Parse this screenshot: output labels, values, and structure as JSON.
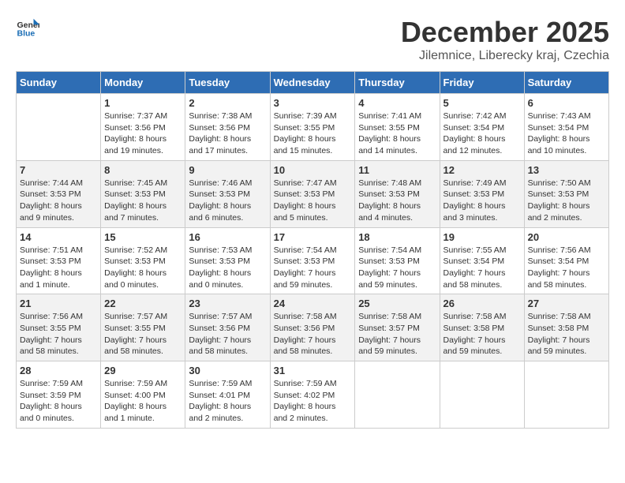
{
  "logo": {
    "general": "General",
    "blue": "Blue"
  },
  "title": "December 2025",
  "location": "Jilemnice, Liberecky kraj, Czechia",
  "days_of_week": [
    "Sunday",
    "Monday",
    "Tuesday",
    "Wednesday",
    "Thursday",
    "Friday",
    "Saturday"
  ],
  "weeks": [
    [
      {
        "day": "",
        "sunrise": "",
        "sunset": "",
        "daylight": ""
      },
      {
        "day": "1",
        "sunrise": "Sunrise: 7:37 AM",
        "sunset": "Sunset: 3:56 PM",
        "daylight": "Daylight: 8 hours and 19 minutes."
      },
      {
        "day": "2",
        "sunrise": "Sunrise: 7:38 AM",
        "sunset": "Sunset: 3:56 PM",
        "daylight": "Daylight: 8 hours and 17 minutes."
      },
      {
        "day": "3",
        "sunrise": "Sunrise: 7:39 AM",
        "sunset": "Sunset: 3:55 PM",
        "daylight": "Daylight: 8 hours and 15 minutes."
      },
      {
        "day": "4",
        "sunrise": "Sunrise: 7:41 AM",
        "sunset": "Sunset: 3:55 PM",
        "daylight": "Daylight: 8 hours and 14 minutes."
      },
      {
        "day": "5",
        "sunrise": "Sunrise: 7:42 AM",
        "sunset": "Sunset: 3:54 PM",
        "daylight": "Daylight: 8 hours and 12 minutes."
      },
      {
        "day": "6",
        "sunrise": "Sunrise: 7:43 AM",
        "sunset": "Sunset: 3:54 PM",
        "daylight": "Daylight: 8 hours and 10 minutes."
      }
    ],
    [
      {
        "day": "7",
        "sunrise": "Sunrise: 7:44 AM",
        "sunset": "Sunset: 3:53 PM",
        "daylight": "Daylight: 8 hours and 9 minutes."
      },
      {
        "day": "8",
        "sunrise": "Sunrise: 7:45 AM",
        "sunset": "Sunset: 3:53 PM",
        "daylight": "Daylight: 8 hours and 7 minutes."
      },
      {
        "day": "9",
        "sunrise": "Sunrise: 7:46 AM",
        "sunset": "Sunset: 3:53 PM",
        "daylight": "Daylight: 8 hours and 6 minutes."
      },
      {
        "day": "10",
        "sunrise": "Sunrise: 7:47 AM",
        "sunset": "Sunset: 3:53 PM",
        "daylight": "Daylight: 8 hours and 5 minutes."
      },
      {
        "day": "11",
        "sunrise": "Sunrise: 7:48 AM",
        "sunset": "Sunset: 3:53 PM",
        "daylight": "Daylight: 8 hours and 4 minutes."
      },
      {
        "day": "12",
        "sunrise": "Sunrise: 7:49 AM",
        "sunset": "Sunset: 3:53 PM",
        "daylight": "Daylight: 8 hours and 3 minutes."
      },
      {
        "day": "13",
        "sunrise": "Sunrise: 7:50 AM",
        "sunset": "Sunset: 3:53 PM",
        "daylight": "Daylight: 8 hours and 2 minutes."
      }
    ],
    [
      {
        "day": "14",
        "sunrise": "Sunrise: 7:51 AM",
        "sunset": "Sunset: 3:53 PM",
        "daylight": "Daylight: 8 hours and 1 minute."
      },
      {
        "day": "15",
        "sunrise": "Sunrise: 7:52 AM",
        "sunset": "Sunset: 3:53 PM",
        "daylight": "Daylight: 8 hours and 0 minutes."
      },
      {
        "day": "16",
        "sunrise": "Sunrise: 7:53 AM",
        "sunset": "Sunset: 3:53 PM",
        "daylight": "Daylight: 8 hours and 0 minutes."
      },
      {
        "day": "17",
        "sunrise": "Sunrise: 7:54 AM",
        "sunset": "Sunset: 3:53 PM",
        "daylight": "Daylight: 7 hours and 59 minutes."
      },
      {
        "day": "18",
        "sunrise": "Sunrise: 7:54 AM",
        "sunset": "Sunset: 3:53 PM",
        "daylight": "Daylight: 7 hours and 59 minutes."
      },
      {
        "day": "19",
        "sunrise": "Sunrise: 7:55 AM",
        "sunset": "Sunset: 3:54 PM",
        "daylight": "Daylight: 7 hours and 58 minutes."
      },
      {
        "day": "20",
        "sunrise": "Sunrise: 7:56 AM",
        "sunset": "Sunset: 3:54 PM",
        "daylight": "Daylight: 7 hours and 58 minutes."
      }
    ],
    [
      {
        "day": "21",
        "sunrise": "Sunrise: 7:56 AM",
        "sunset": "Sunset: 3:55 PM",
        "daylight": "Daylight: 7 hours and 58 minutes."
      },
      {
        "day": "22",
        "sunrise": "Sunrise: 7:57 AM",
        "sunset": "Sunset: 3:55 PM",
        "daylight": "Daylight: 7 hours and 58 minutes."
      },
      {
        "day": "23",
        "sunrise": "Sunrise: 7:57 AM",
        "sunset": "Sunset: 3:56 PM",
        "daylight": "Daylight: 7 hours and 58 minutes."
      },
      {
        "day": "24",
        "sunrise": "Sunrise: 7:58 AM",
        "sunset": "Sunset: 3:56 PM",
        "daylight": "Daylight: 7 hours and 58 minutes."
      },
      {
        "day": "25",
        "sunrise": "Sunrise: 7:58 AM",
        "sunset": "Sunset: 3:57 PM",
        "daylight": "Daylight: 7 hours and 59 minutes."
      },
      {
        "day": "26",
        "sunrise": "Sunrise: 7:58 AM",
        "sunset": "Sunset: 3:58 PM",
        "daylight": "Daylight: 7 hours and 59 minutes."
      },
      {
        "day": "27",
        "sunrise": "Sunrise: 7:58 AM",
        "sunset": "Sunset: 3:58 PM",
        "daylight": "Daylight: 7 hours and 59 minutes."
      }
    ],
    [
      {
        "day": "28",
        "sunrise": "Sunrise: 7:59 AM",
        "sunset": "Sunset: 3:59 PM",
        "daylight": "Daylight: 8 hours and 0 minutes."
      },
      {
        "day": "29",
        "sunrise": "Sunrise: 7:59 AM",
        "sunset": "Sunset: 4:00 PM",
        "daylight": "Daylight: 8 hours and 1 minute."
      },
      {
        "day": "30",
        "sunrise": "Sunrise: 7:59 AM",
        "sunset": "Sunset: 4:01 PM",
        "daylight": "Daylight: 8 hours and 2 minutes."
      },
      {
        "day": "31",
        "sunrise": "Sunrise: 7:59 AM",
        "sunset": "Sunset: 4:02 PM",
        "daylight": "Daylight: 8 hours and 2 minutes."
      },
      {
        "day": "",
        "sunrise": "",
        "sunset": "",
        "daylight": ""
      },
      {
        "day": "",
        "sunrise": "",
        "sunset": "",
        "daylight": ""
      },
      {
        "day": "",
        "sunrise": "",
        "sunset": "",
        "daylight": ""
      }
    ]
  ]
}
